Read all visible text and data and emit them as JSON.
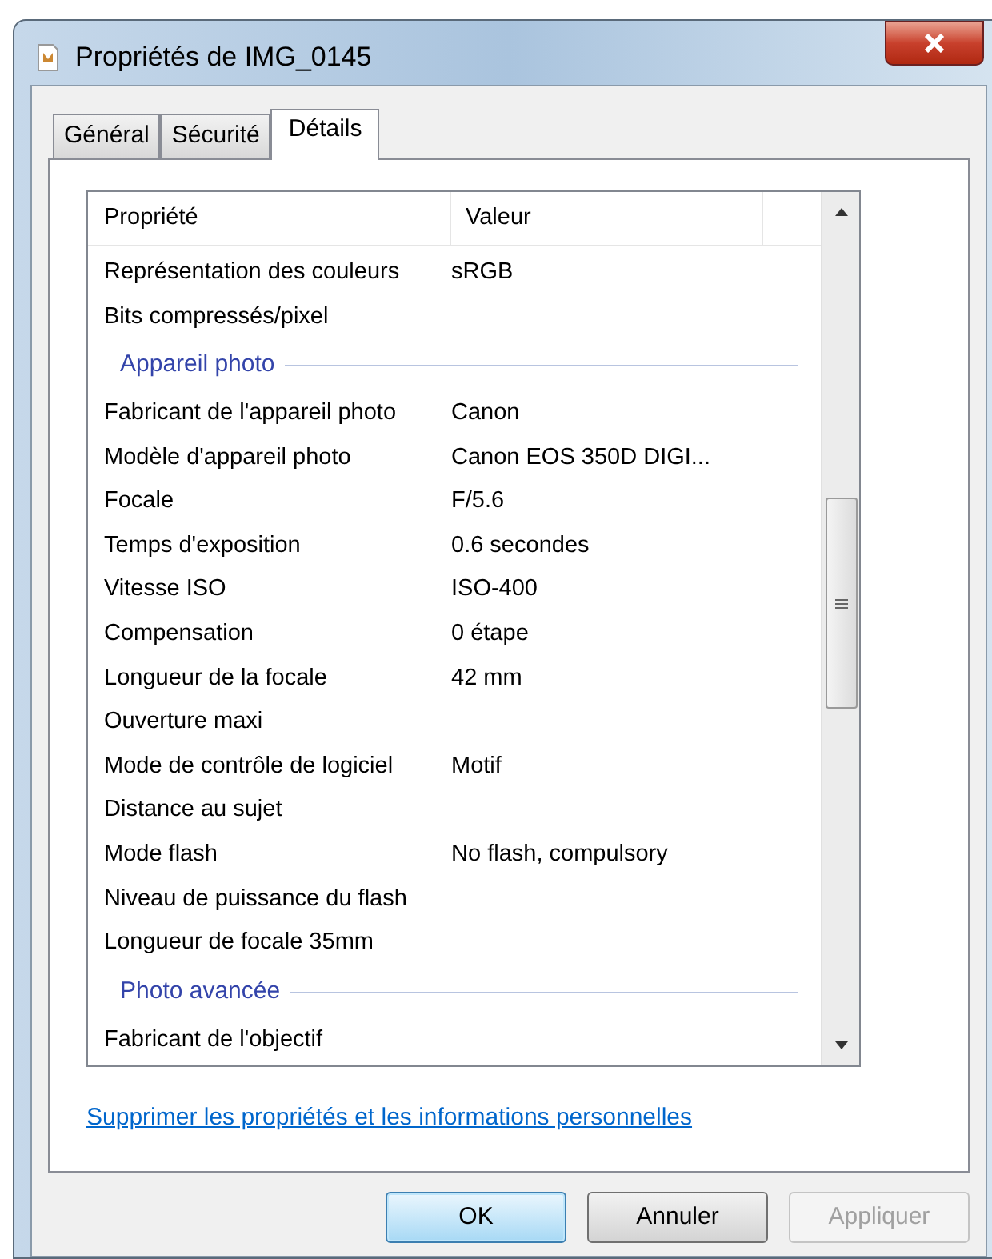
{
  "window": {
    "title": "Propriétés de IMG_0145"
  },
  "tabs": [
    {
      "label": "Général",
      "selected": false
    },
    {
      "label": "Sécurité",
      "selected": false
    },
    {
      "label": "Détails",
      "selected": true
    }
  ],
  "table": {
    "columns": [
      "Propriété",
      "Valeur"
    ],
    "rows": [
      {
        "kind": "property",
        "name": "Représentation des couleurs",
        "value": "sRGB"
      },
      {
        "kind": "property",
        "name": "Bits compressés/pixel"
      },
      {
        "kind": "group",
        "name": "Appareil photo"
      },
      {
        "kind": "property",
        "name": "Fabricant de l'appareil photo",
        "value": "Canon"
      },
      {
        "kind": "property",
        "name": "Modèle d'appareil photo",
        "value": "Canon EOS 350D DIGI..."
      },
      {
        "kind": "property",
        "name": "Focale",
        "value": "F/5.6"
      },
      {
        "kind": "property",
        "name": "Temps d'exposition",
        "value": "0.6 secondes"
      },
      {
        "kind": "property",
        "name": "Vitesse ISO",
        "value": "ISO-400"
      },
      {
        "kind": "property",
        "name": "Compensation",
        "value": "0 étape"
      },
      {
        "kind": "property",
        "name": "Longueur de la focale",
        "value": "42 mm"
      },
      {
        "kind": "property",
        "name": "Ouverture maxi"
      },
      {
        "kind": "property",
        "name": "Mode de contrôle de logiciel",
        "value": "Motif"
      },
      {
        "kind": "property",
        "name": "Distance au sujet"
      },
      {
        "kind": "property",
        "name": "Mode flash",
        "value": "No flash, compulsory"
      },
      {
        "kind": "property",
        "name": "Niveau de puissance du flash"
      },
      {
        "kind": "property",
        "name": "Longueur de focale 35mm"
      },
      {
        "kind": "group",
        "name": "Photo avancée"
      },
      {
        "kind": "property",
        "name": "Fabricant de l'objectif"
      }
    ]
  },
  "link": "Supprimer les propriétés et les informations personnelles",
  "buttons": [
    {
      "label": "OK",
      "kind": "default",
      "disabled": false
    },
    {
      "label": "Annuler",
      "kind": "normal",
      "disabled": false
    },
    {
      "label": "Appliquer",
      "kind": "normal",
      "disabled": true
    }
  ]
}
